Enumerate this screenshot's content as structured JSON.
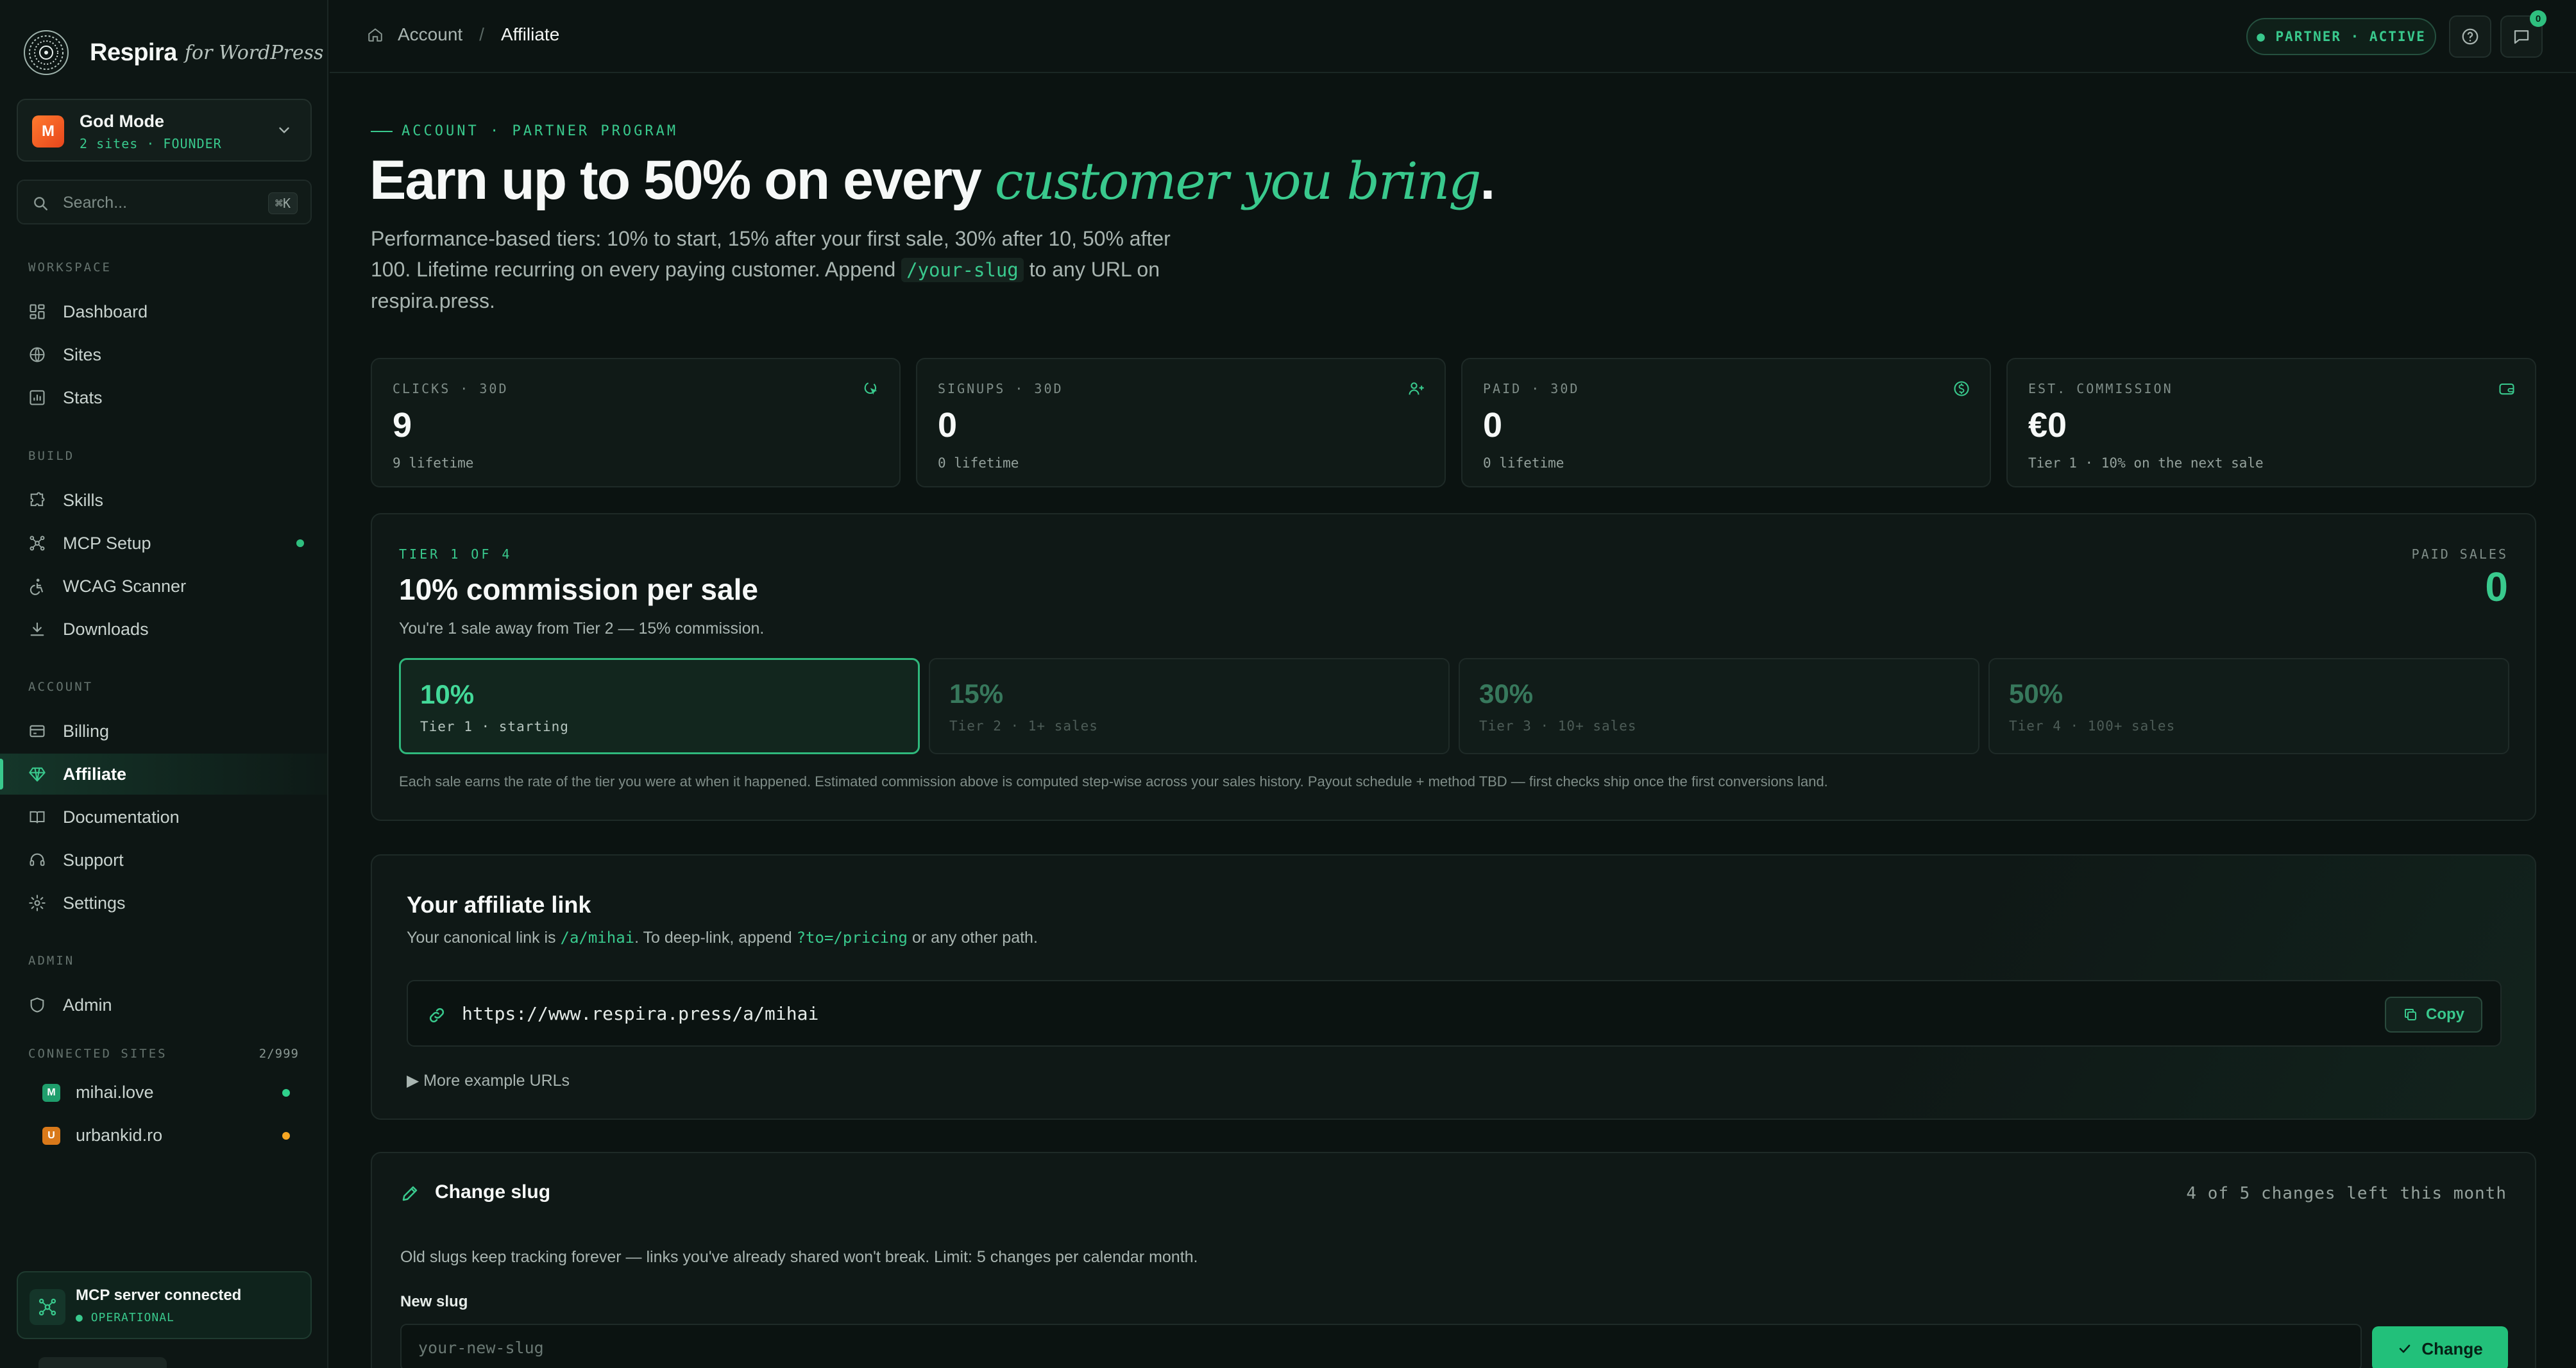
{
  "brand": {
    "name": "Respira",
    "sub": "for WordPress"
  },
  "account": {
    "initial": "M",
    "name": "God Mode",
    "meta": "2 sites · FOUNDER"
  },
  "search": {
    "placeholder": "Search...",
    "shortcut": "⌘K"
  },
  "sidebar": {
    "sections": [
      {
        "title": "WORKSPACE",
        "items": [
          {
            "label": "Dashboard",
            "icon": "dashboard-icon"
          },
          {
            "label": "Sites",
            "icon": "globe-icon"
          },
          {
            "label": "Stats",
            "icon": "chart-icon"
          }
        ]
      },
      {
        "title": "BUILD",
        "items": [
          {
            "label": "Skills",
            "icon": "puzzle-icon"
          },
          {
            "label": "MCP Setup",
            "icon": "network-icon",
            "status": "green"
          },
          {
            "label": "WCAG Scanner",
            "icon": "accessibility-icon"
          },
          {
            "label": "Downloads",
            "icon": "download-icon"
          }
        ]
      },
      {
        "title": "ACCOUNT",
        "items": [
          {
            "label": "Billing",
            "icon": "billing-icon"
          },
          {
            "label": "Affiliate",
            "icon": "diamond-icon",
            "active": true
          },
          {
            "label": "Documentation",
            "icon": "book-icon"
          },
          {
            "label": "Support",
            "icon": "support-icon"
          },
          {
            "label": "Settings",
            "icon": "gear-icon"
          }
        ]
      },
      {
        "title": "ADMIN",
        "items": [
          {
            "label": "Admin",
            "icon": "shield-icon"
          }
        ]
      }
    ],
    "connected_sites": {
      "title": "CONNECTED SITES",
      "count": "2/999",
      "sites": [
        {
          "badge": "M",
          "name": "mihai.love",
          "badge_color": "#1f9e6c",
          "status_color": "#2fd18c"
        },
        {
          "badge": "U",
          "name": "urbankid.ro",
          "badge_color": "#d9791a",
          "status_color": "#f5a623"
        }
      ]
    },
    "mcp": {
      "title": "MCP server connected",
      "status": "OPERATIONAL"
    }
  },
  "topbar": {
    "breadcrumb": [
      "Account",
      "Affiliate"
    ],
    "partner_status": "PARTNER · ACTIVE",
    "notifications": "0"
  },
  "hero": {
    "eyebrow": "ACCOUNT · PARTNER PROGRAM",
    "title_main": "Earn up to 50% on every ",
    "title_accent": "customer you bring",
    "title_end": ".",
    "desc_1": "Performance-based tiers: 10% to start, 15% after your first sale, 30% after 10, 50% after 100. Lifetime recurring on every paying customer. Append ",
    "desc_code": "/your-slug",
    "desc_2": " to any URL on respira.press."
  },
  "stats": [
    {
      "label": "CLICKS · 30D",
      "value": "9",
      "sub": "9 lifetime",
      "icon": "cursor-click-icon"
    },
    {
      "label": "SIGNUPS · 30D",
      "value": "0",
      "sub": "0 lifetime",
      "icon": "user-plus-icon"
    },
    {
      "label": "PAID · 30D",
      "value": "0",
      "sub": "0 lifetime",
      "icon": "coin-icon"
    },
    {
      "label": "EST. COMMISSION",
      "value": "€0",
      "sub": "Tier 1 · 10% on the next sale",
      "icon": "wallet-icon"
    }
  ],
  "tier": {
    "eyebrow": "TIER 1 OF 4",
    "title": "10% commission per sale",
    "subtitle": "You're 1 sale away from Tier 2 — 15% commission.",
    "paid_label": "PAID SALES",
    "paid_value": "0",
    "tiers": [
      {
        "pct": "10%",
        "name": "Tier 1 · starting",
        "active": true
      },
      {
        "pct": "15%",
        "name": "Tier 2 · 1+ sales"
      },
      {
        "pct": "30%",
        "name": "Tier 3 · 10+ sales"
      },
      {
        "pct": "50%",
        "name": "Tier 4 · 100+ sales"
      }
    ],
    "note": "Each sale earns the rate of the tier you were at when it happened. Estimated commission above is computed step-wise across your sales history. Payout schedule + method TBD — first checks ship once the first conversions land."
  },
  "affiliate_link": {
    "title": "Your affiliate link",
    "desc_1": "Your canonical link is ",
    "desc_code1": "/a/mihai",
    "desc_2": ". To deep-link, append ",
    "desc_code2": "?to=/pricing",
    "desc_3": " or any other path.",
    "url": "https://www.respira.press/a/mihai",
    "copy_label": "Copy",
    "more_label": "▶ More example URLs"
  },
  "slug": {
    "title": "Change slug",
    "changes_left": "4 of 5 changes left this month",
    "desc": "Old slugs keep tracking forever — links you've already shared won't break. Limit: 5 changes per calendar month.",
    "label": "New slug",
    "placeholder": "your-new-slug",
    "button": "Change"
  },
  "colors": {
    "accent": "#39c98d",
    "background": "#0b1311",
    "card": "#0f1816"
  }
}
